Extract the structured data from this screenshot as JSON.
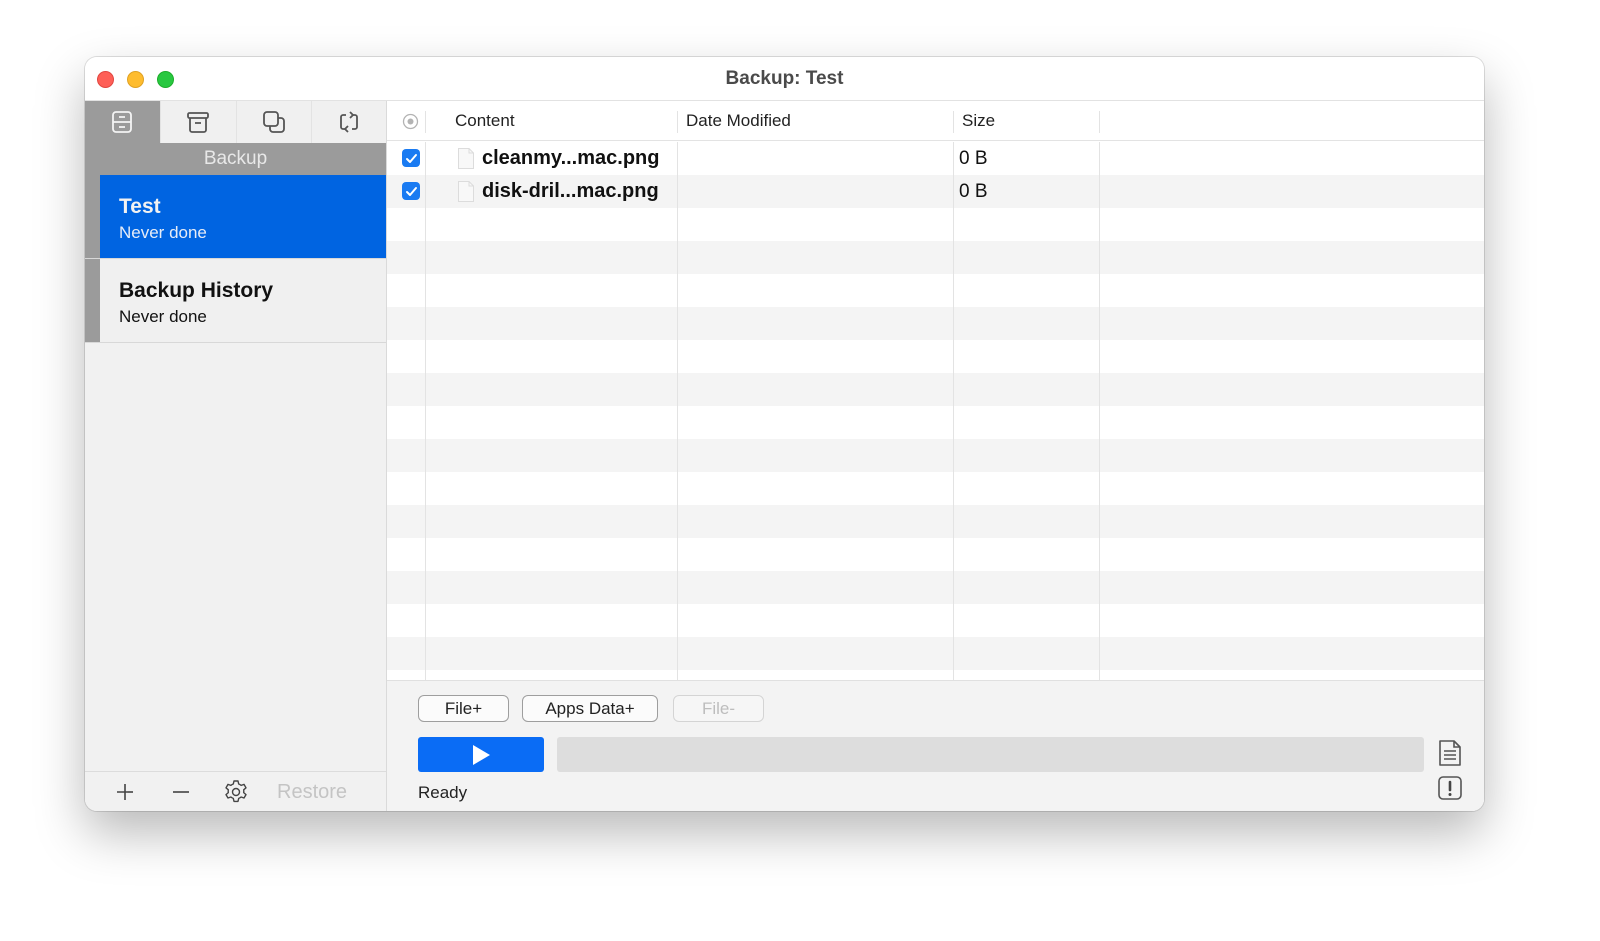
{
  "window": {
    "title": "Backup: Test"
  },
  "sidebar": {
    "tabs": [
      {
        "icon": "drawer-icon",
        "active": true
      },
      {
        "icon": "archive-box-icon",
        "active": false
      },
      {
        "icon": "duplicate-squares-icon",
        "active": false
      },
      {
        "icon": "sync-arrows-icon",
        "active": false
      }
    ],
    "section_title": "Backup",
    "jobs": [
      {
        "name": "Test",
        "status": "Never done",
        "selected": true
      },
      {
        "name": "Backup History",
        "status": "Never done",
        "selected": false
      }
    ],
    "footer": {
      "add_label": "+",
      "remove_label": "—",
      "settings_icon": "gear-icon",
      "restore_label": "Restore"
    }
  },
  "table": {
    "columns": [
      "Content",
      "Date Modified",
      "Size"
    ],
    "header_icon": "target-circle-icon",
    "rows": [
      {
        "checked": true,
        "name": "cleanmy...mac.png",
        "date_modified": "",
        "size": "0 B"
      },
      {
        "checked": true,
        "name": "disk-dril...mac.png",
        "date_modified": "",
        "size": "0 B"
      }
    ]
  },
  "controls": {
    "file_add_label": "File+",
    "apps_data_add_label": "Apps Data+",
    "file_remove_label": "File-",
    "play_icon": "play-icon",
    "progress_percent": 0,
    "status": "Ready",
    "log_icon": "document-icon",
    "alert_icon": "exclamation-icon"
  },
  "colors": {
    "accent": "#0a6cf5",
    "selection": "#0064e1",
    "sidebar_header": "#9b9b9b"
  }
}
